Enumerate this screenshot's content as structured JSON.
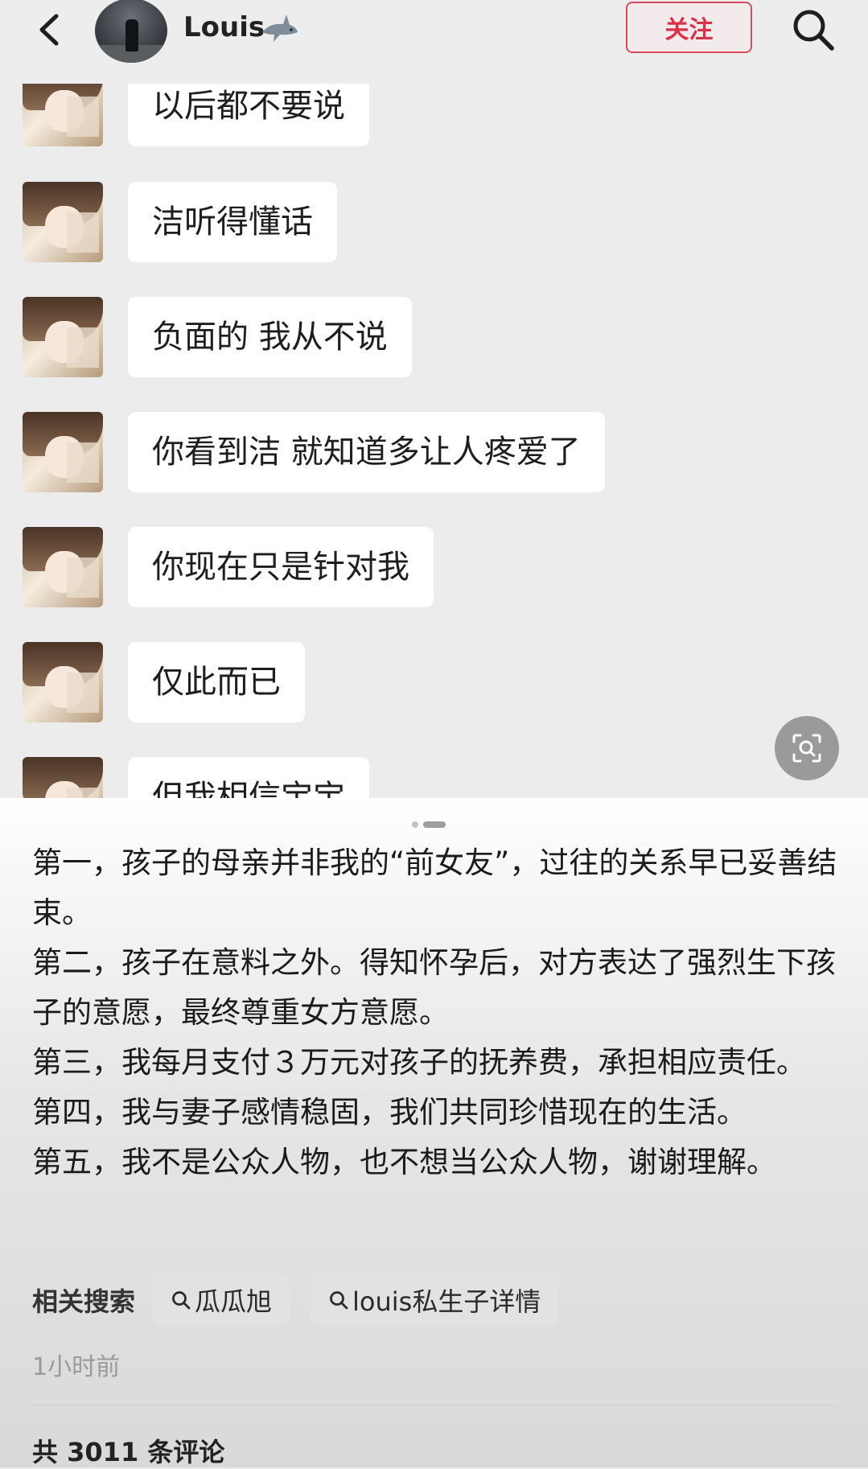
{
  "header": {
    "username": "Louis",
    "follow_label": "关注"
  },
  "chat": {
    "messages": [
      {
        "text": "以后都不要说"
      },
      {
        "text": "洁听得懂话"
      },
      {
        "text": "负面的 我从不说"
      },
      {
        "text": "你看到洁 就知道多让人疼爱了"
      },
      {
        "text": "你现在只是针对我"
      },
      {
        "text": "仅此而已"
      },
      {
        "text": "但我相信宝宝"
      }
    ]
  },
  "article": {
    "paragraphs": [
      "第一，孩子的母亲并非我的“前女友”，过往的关系早已妥善结束。",
      "第二，孩子在意料之外。得知怀孕后，对方表达了强烈生下孩子的意愿，最终尊重女方意愿。",
      "第三，我每月支付３万元对孩子的抚养费，承担相应责任。",
      "第四，我与妻子感情稳固，我们共同珍惜现在的生活。",
      "第五，我不是公众人物，也不想当公众人物，谢谢理解。"
    ]
  },
  "related": {
    "label": "相关搜索",
    "chips": [
      {
        "label": "瓜瓜旭"
      },
      {
        "label": "louis私生子详情"
      }
    ]
  },
  "meta": {
    "time": "1小时前",
    "comment_count": "共 3011 条评论"
  },
  "colors": {
    "follow_accent": "#d8314a",
    "bubble": "#ffffff",
    "chat_bg": "#ececec"
  },
  "icons": [
    "back-icon",
    "shark-icon",
    "search-icon",
    "image-search-icon"
  ]
}
